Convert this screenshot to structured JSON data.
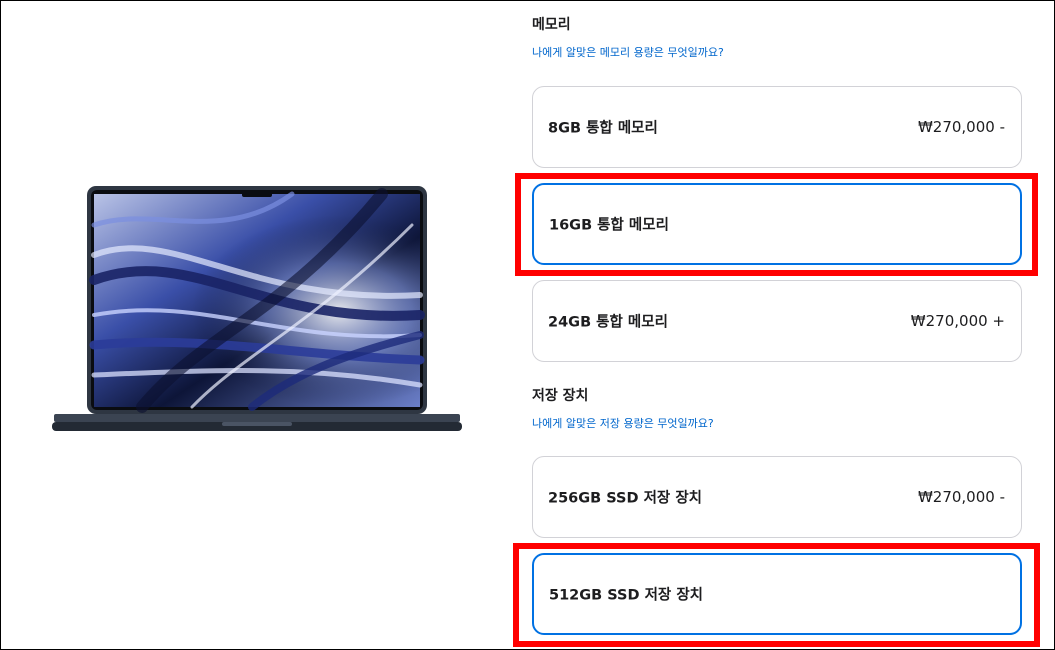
{
  "memory": {
    "title": "메모리",
    "help_link": "나에게 알맞은 메모리 용량은 무엇일까요?",
    "options": [
      {
        "label": "8GB 통합 메모리",
        "price": "₩270,000 -"
      },
      {
        "label": "16GB 통합 메모리",
        "price": ""
      },
      {
        "label": "24GB 통합 메모리",
        "price": "₩270,000 +"
      }
    ]
  },
  "storage": {
    "title": "저장 장치",
    "help_link": "나에게 알맞은 저장 용량은 무엇일까요?",
    "options": [
      {
        "label": "256GB SSD 저장 장치",
        "price": "₩270,000 -"
      },
      {
        "label": "512GB SSD 저장 장치",
        "price": ""
      }
    ]
  },
  "colors": {
    "accent": "#0071e3",
    "link": "#0066cc",
    "highlight": "#ff0000",
    "border": "#d2d2d7",
    "laptop_body": "#2e3642"
  }
}
